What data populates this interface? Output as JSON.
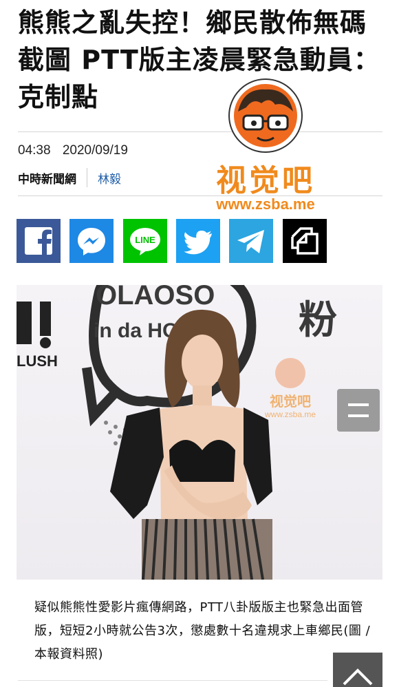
{
  "article": {
    "headline": "熊熊之亂失控！鄉民散佈無碼截圖 PTT版主凌晨緊急動員：克制點",
    "time": "04:38 2020/09/19",
    "source": "中時新聞網",
    "author": "林毅"
  },
  "watermark": {
    "brand": "视觉吧",
    "url": "www.zsba.me"
  },
  "share": [
    {
      "name": "facebook",
      "icon": "facebook-icon",
      "color": "#3b5998"
    },
    {
      "name": "messenger",
      "icon": "messenger-icon",
      "color": "#1e88e5"
    },
    {
      "name": "line",
      "icon": "line-icon",
      "color": "#00c300",
      "label": "LINE"
    },
    {
      "name": "twitter",
      "icon": "twitter-icon",
      "color": "#1da1f2"
    },
    {
      "name": "telegram",
      "icon": "telegram-icon",
      "color": "#2ca5e0"
    },
    {
      "name": "copy-link",
      "icon": "copy-icon",
      "color": "#000000"
    }
  ],
  "photo": {
    "backdrop_text": [
      "OLAOSO",
      "in da HOUSE",
      "粉",
      "LUSH"
    ],
    "watermark_brand": "视觉吧",
    "watermark_url": "www.zsba.me"
  },
  "caption": "疑似熊熊性愛影片瘋傳網路，PTT八卦版版主也緊急出面管版，短短2小時就公告3次，懲處數十名違規求上車鄉民(圖 / 本報資料照)"
}
